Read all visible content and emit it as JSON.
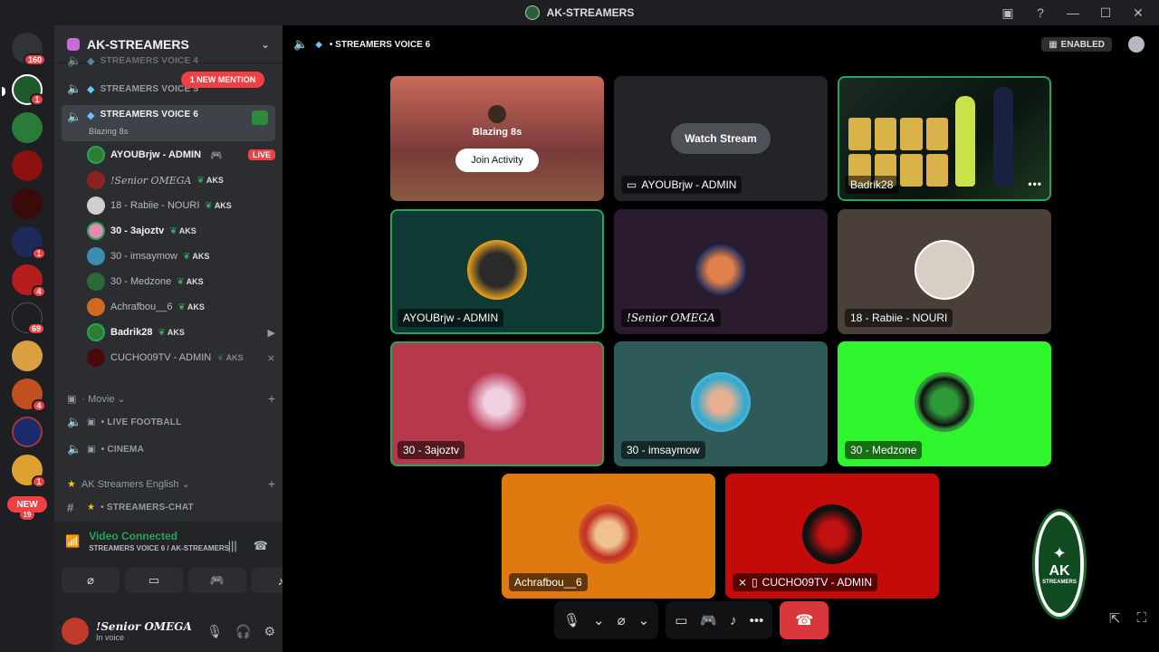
{
  "window": {
    "title": "AK-STREAMERS"
  },
  "rail": {
    "home_badge": "160",
    "badges": [
      "1",
      "1",
      "1",
      "4",
      "69",
      "4",
      "1"
    ],
    "new_label": "NEW",
    "new_count": "19"
  },
  "guild": {
    "name": "AK-STREAMERS"
  },
  "channels": {
    "above1": "STREAMERS VOICE 4",
    "above2": "STREAMERS VOICE 5",
    "mention": "1 NEW MENTION",
    "active": {
      "name": "STREAMERS VOICE 6",
      "activity": "Blazing 8s"
    },
    "live_label": "LIVE",
    "users": [
      {
        "name": "AYOUBrjw - ADMIN"
      },
      {
        "name": "!Senior OMEGA",
        "tag": "AKS"
      },
      {
        "name": "18 - Rabiie - NOURI",
        "tag": "AKS"
      },
      {
        "name": "30 - 3ajoztv",
        "tag": "AKS"
      },
      {
        "name": "30 - imsaymow",
        "tag": "AKS"
      },
      {
        "name": "30 - Medzone",
        "tag": "AKS"
      },
      {
        "name": "Achrafbou__6",
        "tag": "AKS"
      },
      {
        "name": "Badrik28",
        "tag": "AKS"
      },
      {
        "name": "CUCHO09TV - ADMIN",
        "tag": "AKS"
      }
    ],
    "cat_movie": "Movie",
    "live_football": "LIVE FOOTBALL",
    "cinema": "CINEMA",
    "cat_english": "AK Streamers English",
    "streamers_chat": "STREAMERS-CHAT"
  },
  "voice_panel": {
    "title": "Video Connected",
    "subtitle": "STREAMERS VOICE 6 / AK-STREAMERS"
  },
  "user_panel": {
    "name": "!Senior OMEGA",
    "status": "In voice"
  },
  "main": {
    "channel": "STREAMERS VOICE 6",
    "enabled": "ENABLED"
  },
  "tiles": {
    "activity_title": "Blazing 8s",
    "join_label": "Join Activity",
    "watch_label": "Watch Stream",
    "t_stream": "AYOUBrjw - ADMIN",
    "t_badrik": "Badrik28",
    "t_ayoub": "AYOUBrjw - ADMIN",
    "t_omega": "!Senior OMEGA",
    "t_rabiie": "18 - Rabiie - NOURI",
    "t_3ajoz": "30 - 3ajoztv",
    "t_imsay": "30 - imsaymow",
    "t_medzone": "30 - Medzone",
    "t_achraf": "Achrafbou__6",
    "t_cucho": "CUCHO09TV - ADMIN"
  },
  "watermark": {
    "big": "AK",
    "small": "STREAMERS"
  },
  "colors": {
    "accent_green": "#23a55a",
    "danger": "#da373c",
    "medzone_bg": "#2ff52c"
  }
}
